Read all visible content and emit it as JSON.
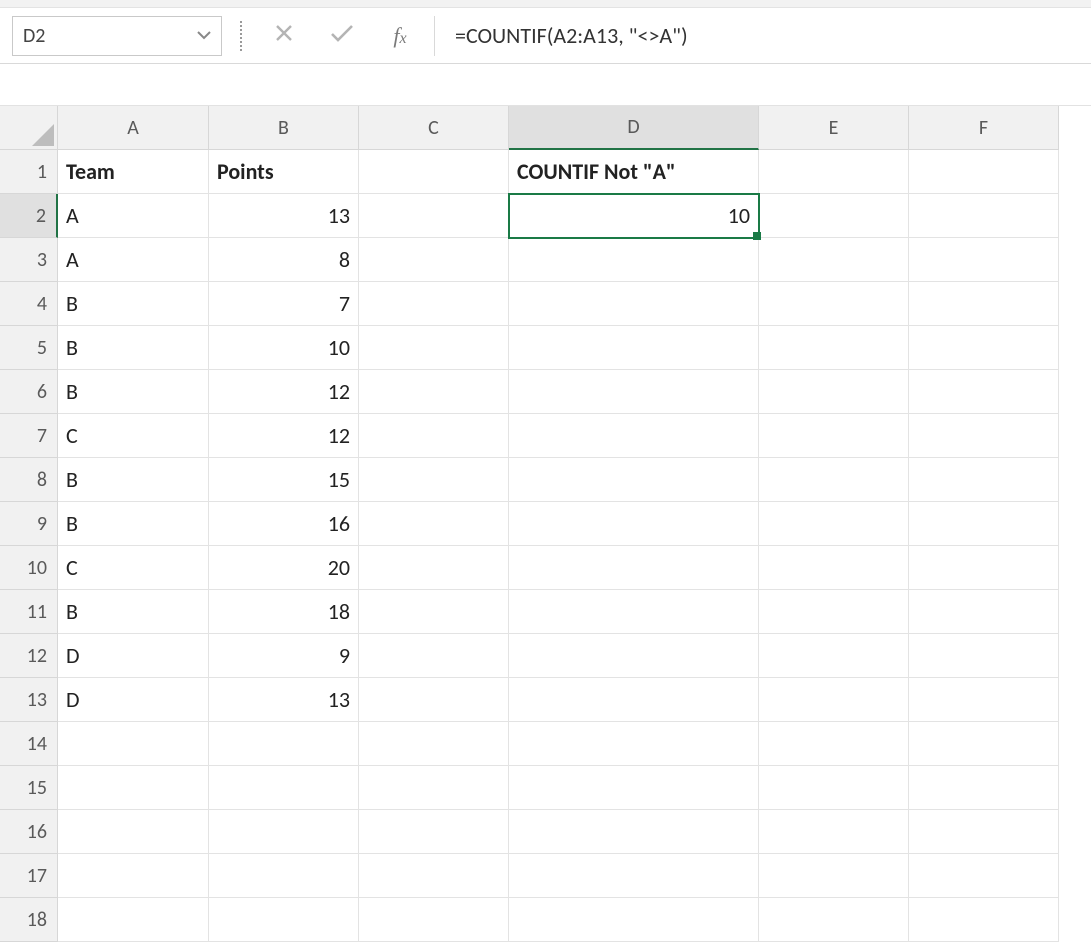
{
  "name_box": {
    "value": "D2"
  },
  "formula_bar": {
    "formula": "=COUNTIF(A2:A13, \"<>A\")"
  },
  "columns": [
    "A",
    "B",
    "C",
    "D",
    "E",
    "F"
  ],
  "rows": [
    "1",
    "2",
    "3",
    "4",
    "5",
    "6",
    "7",
    "8",
    "9",
    "10",
    "11",
    "12",
    "13",
    "14",
    "15",
    "16",
    "17",
    "18"
  ],
  "selected": {
    "col": "D",
    "row": "2"
  },
  "headers": {
    "A1": "Team",
    "B1": "Points",
    "D1": "COUNTIF Not \"A\""
  },
  "team_col": [
    "A",
    "A",
    "B",
    "B",
    "B",
    "C",
    "B",
    "B",
    "C",
    "B",
    "D",
    "D"
  ],
  "points_col": [
    "13",
    "8",
    "7",
    "10",
    "12",
    "12",
    "15",
    "16",
    "20",
    "18",
    "9",
    "13"
  ],
  "result_D2": "10"
}
